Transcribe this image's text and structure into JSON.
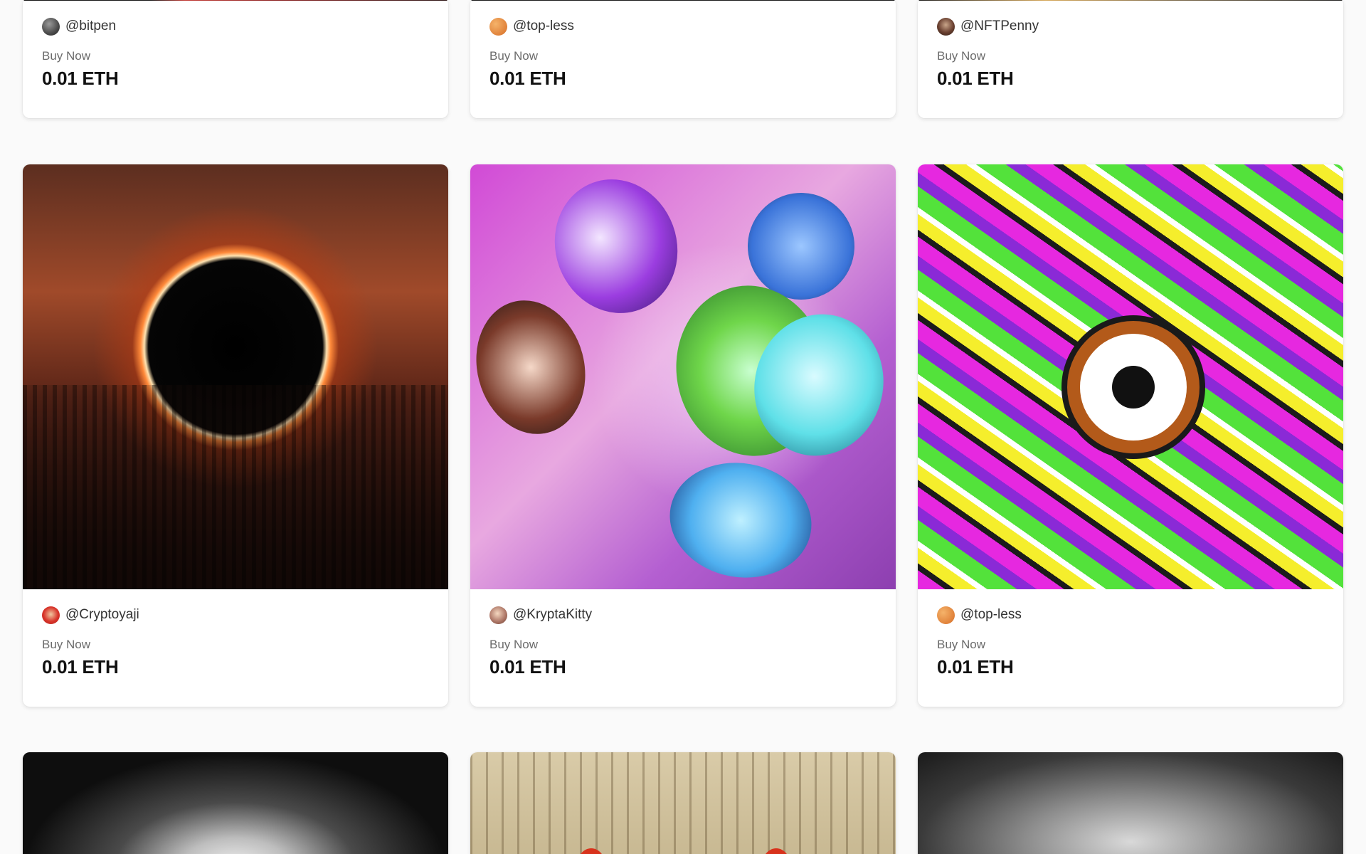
{
  "listings": [
    {
      "handle": "@bitpen",
      "buy_label": "Buy Now",
      "price": "0.01 ETH",
      "avatar_color": "#4a4a4a",
      "artwork": "artwork-partial-top"
    },
    {
      "handle": "@top-less",
      "buy_label": "Buy Now",
      "price": "0.01 ETH",
      "avatar_color": "#e89a4a",
      "artwork": "artwork-partial-top"
    },
    {
      "handle": "@NFTPenny",
      "buy_label": "Buy Now",
      "price": "0.01 ETH",
      "avatar_color": "#5a3a2a",
      "artwork": "artwork-partial-top"
    },
    {
      "handle": "@Cryptoyaji",
      "buy_label": "Buy Now",
      "price": "0.01 ETH",
      "avatar_color": "#d8342a",
      "artwork": "eclipse-city-artwork"
    },
    {
      "handle": "@KryptaKitty",
      "buy_label": "Buy Now",
      "price": "0.01 ETH",
      "avatar_color": "#b07a6a",
      "artwork": "butterflies-artwork"
    },
    {
      "handle": "@top-less",
      "buy_label": "Buy Now",
      "price": "0.01 ETH",
      "avatar_color": "#e89a4a",
      "artwork": "psychedelic-doodle-artwork"
    },
    {
      "artwork": "hooded-ghost-artwork"
    },
    {
      "artwork": "ornate-temple-artwork"
    },
    {
      "artwork": "monochrome-face-artwork"
    }
  ],
  "theme": {
    "page_background": "#fafafa",
    "card_background": "#ffffff",
    "handle_color": "#333333",
    "label_color": "#6b6b6b",
    "price_color": "#111111"
  }
}
